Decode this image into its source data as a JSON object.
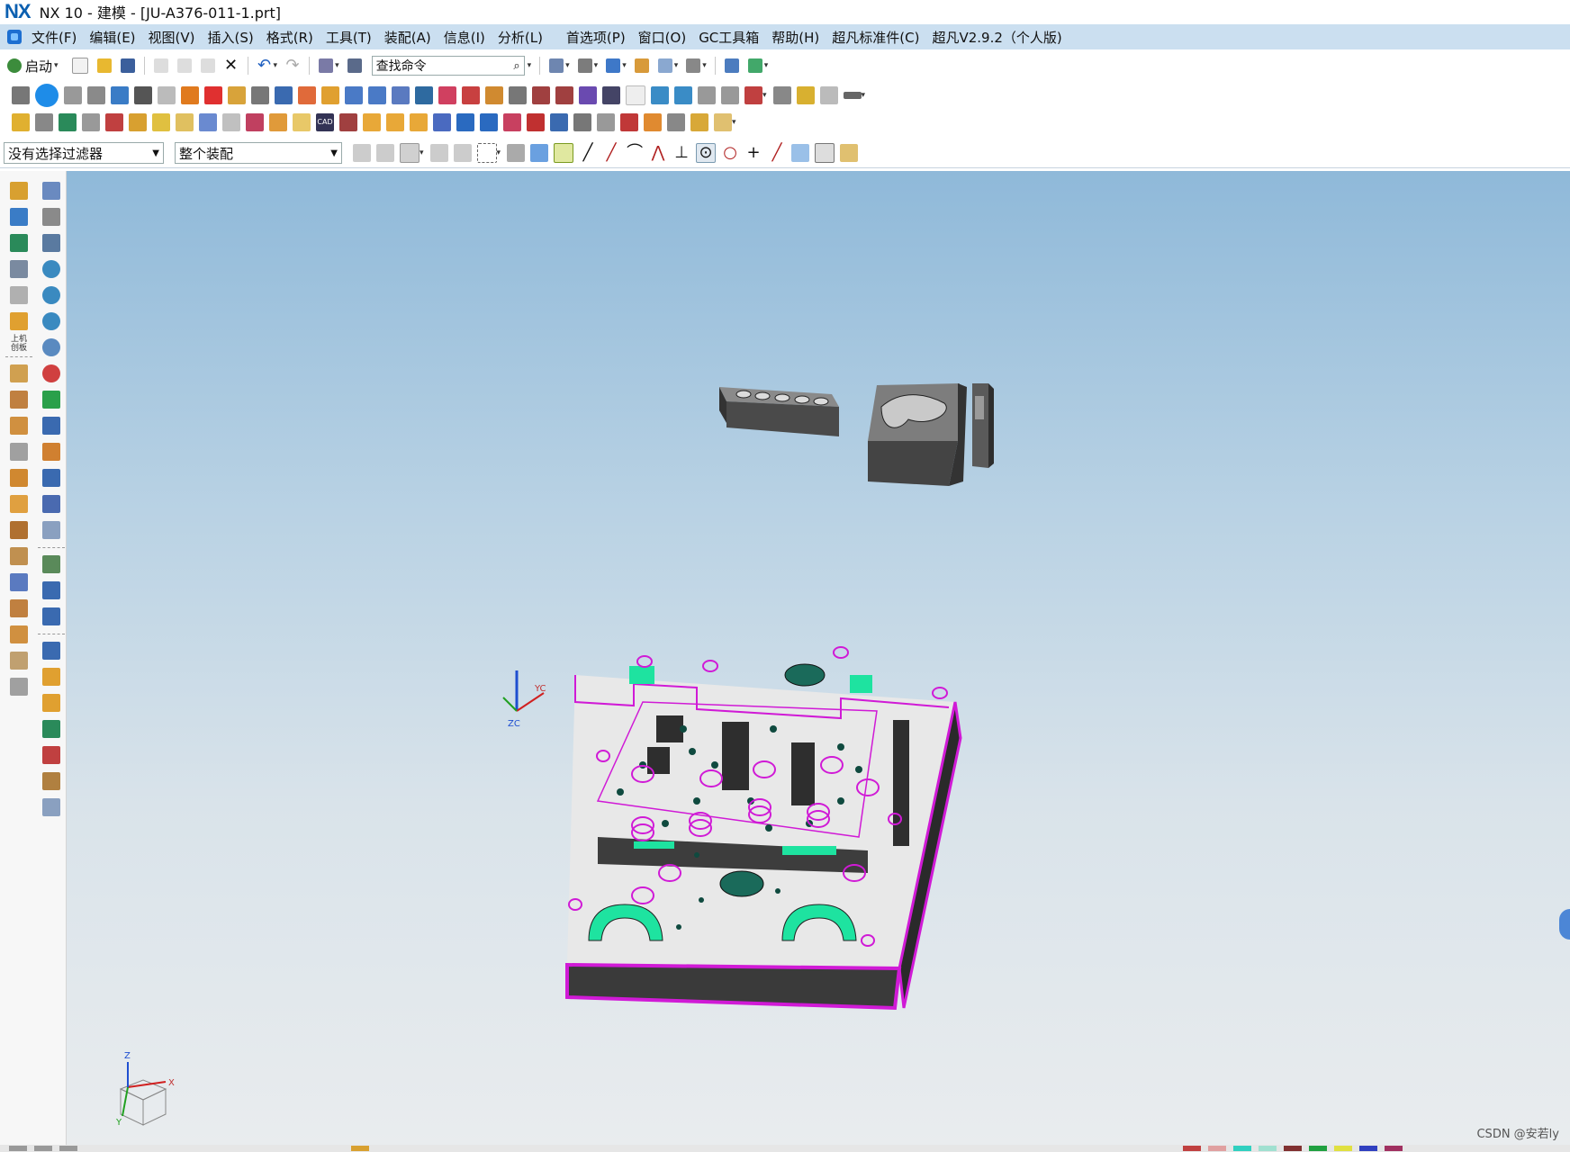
{
  "window": {
    "logo": "NX",
    "title": "NX 10 - 建模 - [JU-A376-011-1.prt]"
  },
  "menu": {
    "items": [
      "文件(F)",
      "编辑(E)",
      "视图(V)",
      "插入(S)",
      "格式(R)",
      "工具(T)",
      "装配(A)",
      "信息(I)",
      "分析(L)",
      "首选项(P)",
      "窗口(O)",
      "GC工具箱",
      "帮助(H)",
      "超凡标准件(C)",
      "超凡V2.9.2（个人版)"
    ]
  },
  "toolbar": {
    "start_label": "启动",
    "search_placeholder": "查找命令",
    "filter_value": "没有选择过滤器",
    "scope_value": "整个装配"
  },
  "sidebar": {
    "tiny_label": "上机\n创板"
  },
  "viewport": {
    "csys_z_label": "ZC",
    "csys_y_label": "YC",
    "triad_x_label": "X",
    "triad_y_label": "Y",
    "triad_z_label": "Z"
  },
  "watermark": "CSDN @安若ly",
  "colors": {
    "menubar": "#cbdff0",
    "viewport_top": "#8fb9d9",
    "viewport_bottom": "#e9ecee",
    "model_edges": "#d01ad6",
    "green_faces": "#1ee3a0",
    "part_body": "#555555"
  }
}
